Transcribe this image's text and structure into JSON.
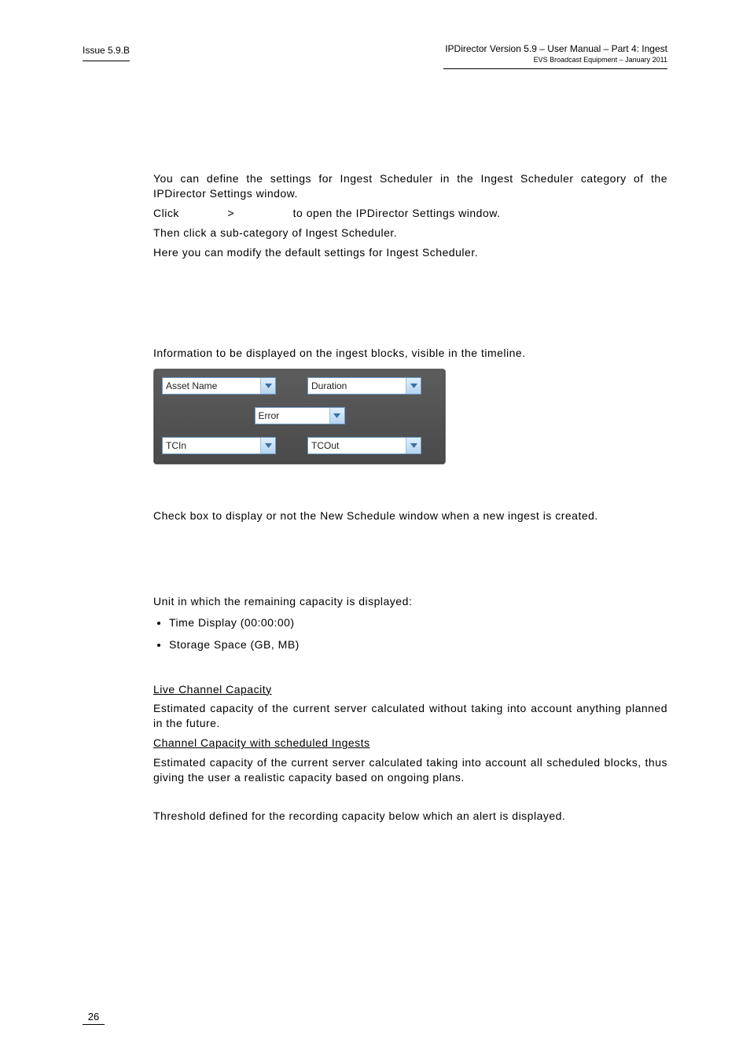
{
  "header": {
    "issue": "Issue 5.9.B",
    "title": "IPDirector Version 5.9 – User Manual – Part 4: Ingest",
    "subtitle": "EVS Broadcast Equipment – January 2011"
  },
  "intro": {
    "p1": "You can define the settings for Ingest Scheduler in the Ingest Scheduler category of the IPDirector Settings window.",
    "p2a": "Click",
    "p2b": ">",
    "p2c": "to open the IPDirector Settings window.",
    "p3": "Then click a sub-category of Ingest Scheduler.",
    "p4": "Here you can modify the default settings for Ingest Scheduler."
  },
  "section_blocks": {
    "lead": "Information to be displayed on the ingest blocks, visible in the timeline.",
    "combos": {
      "asset_name": "Asset Name",
      "duration": "Duration",
      "error": "Error",
      "tcin": "TCIn",
      "tcout": "TCOut"
    }
  },
  "section_checkbox": {
    "text": "Check box to display or not the New Schedule window when a new ingest is created."
  },
  "section_unit": {
    "lead": "Unit in which the remaining capacity is displayed:",
    "bullets": {
      "b1": "Time Display (00:00:00)",
      "b2": "Storage Space (GB, MB)"
    }
  },
  "section_capacity": {
    "live_heading": "Live Channel Capacity",
    "live_text": "Estimated capacity of the current server calculated without taking into account anything planned in the future.",
    "sched_heading": "Channel Capacity with scheduled Ingests",
    "sched_text": "Estimated capacity of the current server calculated taking into account all scheduled blocks, thus giving the user a realistic capacity based on ongoing plans."
  },
  "section_threshold": {
    "text": "Threshold defined for the recording capacity below which an alert is displayed."
  },
  "footer": {
    "page_number": "26"
  }
}
